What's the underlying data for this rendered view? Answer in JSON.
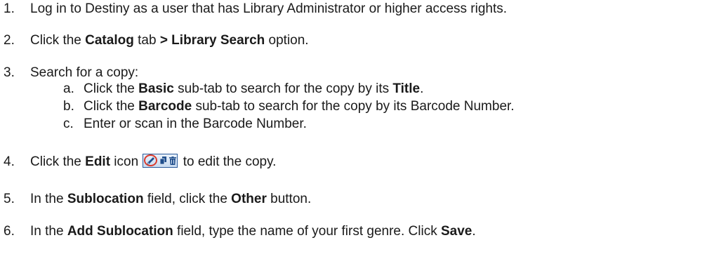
{
  "steps": [
    {
      "num": "1.",
      "parts": [
        "Log in to Destiny as a user that has Library Administrator or higher access rights."
      ]
    },
    {
      "num": "2.",
      "parts": [
        "Click the ",
        "Catalog",
        " tab ",
        "> Library Search",
        " option."
      ]
    },
    {
      "num": "3.",
      "parts": [
        "Search for a copy:"
      ]
    },
    {
      "num": "4.",
      "parts": [
        "Click the ",
        "Edit",
        " icon ",
        " to edit the copy."
      ]
    },
    {
      "num": "5.",
      "parts": [
        "In the ",
        "Sublocation",
        " field, click the ",
        "Other",
        " button."
      ]
    },
    {
      "num": "6.",
      "parts": [
        "In the ",
        "Add Sublocation",
        " field, type the name of your first genre. Click ",
        "Save",
        "."
      ]
    }
  ],
  "substeps": [
    {
      "letter": "a.",
      "parts": [
        "Click the ",
        "Basic",
        " sub-tab to search for the copy by its ",
        "Title",
        "."
      ]
    },
    {
      "letter": "b.",
      "parts": [
        "Click the ",
        "Barcode",
        " sub-tab to search for the copy by its Barcode Number."
      ]
    },
    {
      "letter": "c.",
      "parts": [
        "Enter or scan in the Barcode Number."
      ]
    }
  ],
  "icons": {
    "edit": "pencil-icon",
    "copy": "copy-icon",
    "delete": "trash-icon"
  },
  "colors": {
    "highlight_ring": "#d93a2c",
    "icon_blue": "#2a5a9a"
  }
}
